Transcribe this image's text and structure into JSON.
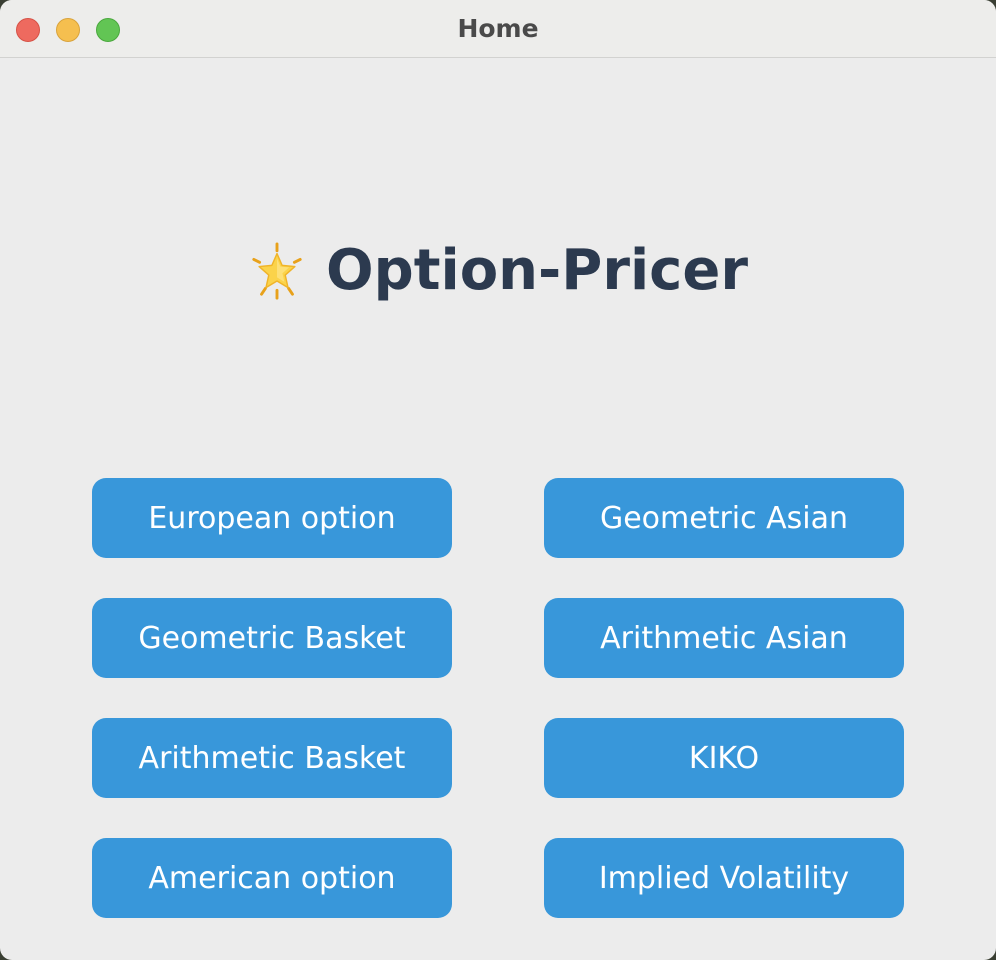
{
  "window": {
    "title": "Home"
  },
  "header": {
    "icon": "glowing-star-icon",
    "title": "Option-Pricer"
  },
  "buttons": [
    {
      "label": "European option"
    },
    {
      "label": "Geometric Asian"
    },
    {
      "label": "Geometric Basket"
    },
    {
      "label": "Arithmetic Asian"
    },
    {
      "label": "Arithmetic Basket"
    },
    {
      "label": "KIKO"
    },
    {
      "label": "American option"
    },
    {
      "label": "Implied Volatility"
    }
  ],
  "colors": {
    "button_bg": "#3897da",
    "button_text": "#ffffff",
    "title_text": "#2c3a4f",
    "window_bg": "#ececec"
  }
}
